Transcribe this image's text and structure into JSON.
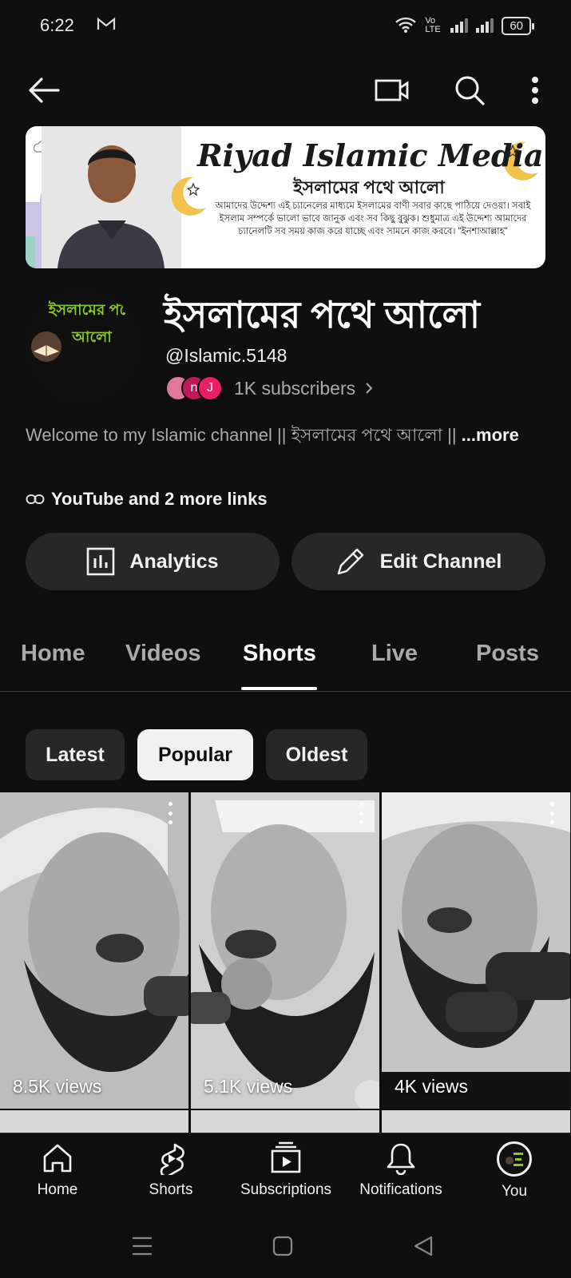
{
  "status_bar": {
    "time": "6:22",
    "network_label": "Vo LTE",
    "battery": "60"
  },
  "banner": {
    "title": "Riyad Islamic Media",
    "subtitle": "ইসলামের পথে আলো",
    "text": "আমাদের উদ্দেশ্য এই চ্যানেলের মাধ্যমে ইসলামের বাণী সবার কাছে পাঠিয়ে দেওয়া। সবাই ইসলাম সম্পর্কে ভালো ভাবে জানুক এবং সব কিছু বুঝুক। শুধুমাত্র এই উদ্দেশ্য আমাদের চ্যানেলটি সব সময় কাজ করে যাচ্ছে এবং সামনে কাজ করবে। \"ইনশাআল্লাহ\""
  },
  "channel": {
    "avatar_text": "ইসলামের পথে আলো",
    "name": "ইসলামের পথে আলো",
    "handle": "@Islamic.5148",
    "subscriber_avatars": [
      "",
      "n",
      "J"
    ],
    "subscribers": "1K subscribers",
    "description": "Welcome to my Islamic channel || ইসলামের পথে  আলো ||",
    "more_label": "...more",
    "links_label": "YouTube and 2 more links",
    "analytics_label": "Analytics",
    "edit_label": "Edit Channel"
  },
  "tabs": [
    {
      "label": "Home"
    },
    {
      "label": "Videos"
    },
    {
      "label": "Shorts",
      "active": true
    },
    {
      "label": "Live"
    },
    {
      "label": "Posts"
    }
  ],
  "chips": [
    {
      "label": "Latest"
    },
    {
      "label": "Popular",
      "selected": true
    },
    {
      "label": "Oldest"
    }
  ],
  "shorts": [
    {
      "views": "8.5K views"
    },
    {
      "views": "5.1K views"
    },
    {
      "views": "4K views"
    }
  ],
  "bottom_nav": [
    {
      "label": "Home",
      "icon": "home-icon"
    },
    {
      "label": "Shorts",
      "icon": "shorts-icon"
    },
    {
      "label": "Subscriptions",
      "icon": "subscriptions-icon"
    },
    {
      "label": "Notifications",
      "icon": "bell-icon"
    },
    {
      "label": "You",
      "icon": "avatar"
    }
  ],
  "colors": {
    "background": "#0f0f0f",
    "surface": "#272727",
    "text_primary": "#f1f1f1",
    "text_secondary": "#aaaaaa",
    "avatar_green": "#8ac926"
  }
}
